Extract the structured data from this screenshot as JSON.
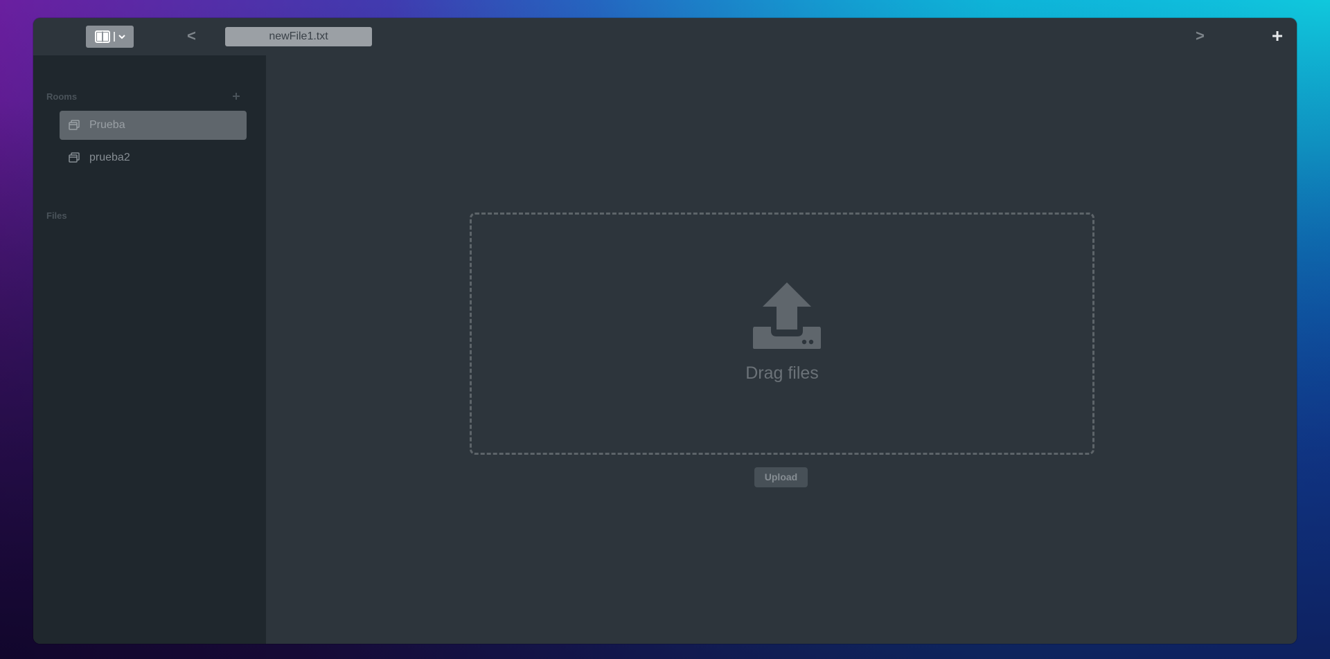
{
  "toolbar": {
    "layout_button_icon": "split-view-icon",
    "prev_label": "<",
    "next_label": ">",
    "active_tab": "newFile1.txt",
    "add_icon": "plus-icon"
  },
  "sidebar": {
    "rooms_title": "Rooms",
    "rooms_add_icon": "plus-icon",
    "rooms": [
      {
        "label": "Prueba",
        "icon": "room-icon",
        "active": true
      },
      {
        "label": "prueba2",
        "icon": "room-icon",
        "active": false
      }
    ],
    "files_title": "Files"
  },
  "main": {
    "dropzone_icon": "upload-icon",
    "drag_label": "Drag files",
    "upload_button": "Upload"
  },
  "colors": {
    "window_bg": "#2d353c",
    "sidebar_bg": "#1f272d",
    "active_item_bg": "#5f666c",
    "dropzone_border": "#5d6469"
  }
}
